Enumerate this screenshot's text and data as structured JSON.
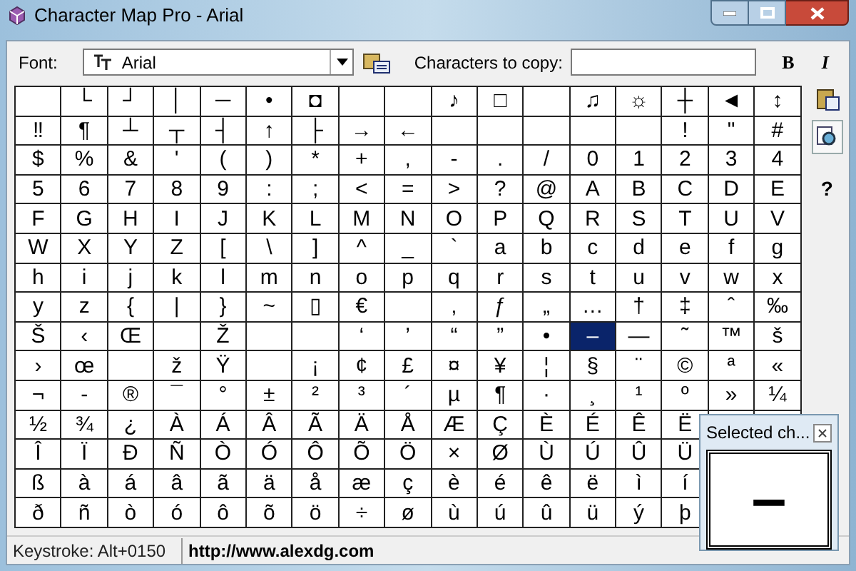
{
  "window": {
    "title": "Character Map Pro - Arial"
  },
  "toolbar": {
    "font_label": "Font:",
    "font_value": "Arial",
    "copy_label": "Characters to copy:",
    "bold": "B",
    "italic": "I"
  },
  "side_toolbar": {
    "help": "?"
  },
  "grid": {
    "rows": [
      [
        {
          "selected": false
        },
        {
          "ch": "└",
          "selected": false
        },
        {
          "ch": "┘",
          "selected": false
        },
        {
          "ch": "│",
          "selected": false
        },
        {
          "ch": "─",
          "selected": false
        },
        {
          "ch": "•",
          "selected": false
        },
        {
          "ch": "◘",
          "selected": false
        },
        {
          "selected": false
        },
        {
          "selected": false
        },
        {
          "ch": "♪",
          "selected": false
        },
        {
          "ch": "□",
          "selected": false
        },
        {
          "selected": false
        },
        {
          "ch": "♫",
          "selected": false
        },
        {
          "ch": "☼",
          "selected": false
        },
        {
          "ch": "┼",
          "selected": false
        },
        {
          "ch": "◄",
          "selected": false
        },
        {
          "ch": "↕",
          "selected": false
        }
      ],
      [
        {
          "ch": "‼",
          "selected": false
        },
        {
          "ch": "¶",
          "selected": false
        },
        {
          "ch": "┴",
          "selected": false
        },
        {
          "ch": "┬",
          "selected": false
        },
        {
          "ch": "┤",
          "selected": false
        },
        {
          "ch": "↑",
          "selected": false
        },
        {
          "ch": "├",
          "selected": false
        },
        {
          "ch": "→",
          "selected": false
        },
        {
          "ch": "←",
          "selected": false
        },
        {
          "selected": false
        },
        {
          "selected": false
        },
        {
          "selected": false
        },
        {
          "selected": false
        },
        {
          "selected": false
        },
        {
          "ch": "!",
          "selected": false
        },
        {
          "ch": "\"",
          "selected": false
        },
        {
          "ch": "#",
          "selected": false
        }
      ],
      [
        {
          "ch": "$",
          "selected": false
        },
        {
          "ch": "%",
          "selected": false
        },
        {
          "ch": "&",
          "selected": false
        },
        {
          "ch": "'",
          "selected": false
        },
        {
          "ch": "(",
          "selected": false
        },
        {
          "ch": ")",
          "selected": false
        },
        {
          "ch": "*",
          "selected": false
        },
        {
          "ch": "+",
          "selected": false
        },
        {
          "ch": ",",
          "selected": false
        },
        {
          "ch": "-",
          "selected": false
        },
        {
          "ch": ".",
          "selected": false
        },
        {
          "ch": "/",
          "selected": false
        },
        {
          "ch": "0",
          "selected": false
        },
        {
          "ch": "1",
          "selected": false
        },
        {
          "ch": "2",
          "selected": false
        },
        {
          "ch": "3",
          "selected": false
        },
        {
          "ch": "4",
          "selected": false
        }
      ],
      [
        {
          "ch": "5",
          "selected": false
        },
        {
          "ch": "6",
          "selected": false
        },
        {
          "ch": "7",
          "selected": false
        },
        {
          "ch": "8",
          "selected": false
        },
        {
          "ch": "9",
          "selected": false
        },
        {
          "ch": ":",
          "selected": false
        },
        {
          "ch": ";",
          "selected": false
        },
        {
          "ch": "<",
          "selected": false
        },
        {
          "ch": "=",
          "selected": false
        },
        {
          "ch": ">",
          "selected": false
        },
        {
          "ch": "?",
          "selected": false
        },
        {
          "ch": "@",
          "selected": false
        },
        {
          "ch": "A",
          "selected": false
        },
        {
          "ch": "B",
          "selected": false
        },
        {
          "ch": "C",
          "selected": false
        },
        {
          "ch": "D",
          "selected": false
        },
        {
          "ch": "E",
          "selected": false
        }
      ],
      [
        {
          "ch": "F",
          "selected": false
        },
        {
          "ch": "G",
          "selected": false
        },
        {
          "ch": "H",
          "selected": false
        },
        {
          "ch": "I",
          "selected": false
        },
        {
          "ch": "J",
          "selected": false
        },
        {
          "ch": "K",
          "selected": false
        },
        {
          "ch": "L",
          "selected": false
        },
        {
          "ch": "M",
          "selected": false
        },
        {
          "ch": "N",
          "selected": false
        },
        {
          "ch": "O",
          "selected": false
        },
        {
          "ch": "P",
          "selected": false
        },
        {
          "ch": "Q",
          "selected": false
        },
        {
          "ch": "R",
          "selected": false
        },
        {
          "ch": "S",
          "selected": false
        },
        {
          "ch": "T",
          "selected": false
        },
        {
          "ch": "U",
          "selected": false
        },
        {
          "ch": "V",
          "selected": false
        }
      ],
      [
        {
          "ch": "W",
          "selected": false
        },
        {
          "ch": "X",
          "selected": false
        },
        {
          "ch": "Y",
          "selected": false
        },
        {
          "ch": "Z",
          "selected": false
        },
        {
          "ch": "[",
          "selected": false
        },
        {
          "ch": "\\",
          "selected": false
        },
        {
          "ch": "]",
          "selected": false
        },
        {
          "ch": "^",
          "selected": false
        },
        {
          "ch": "_",
          "selected": false
        },
        {
          "ch": "`",
          "selected": false
        },
        {
          "ch": "a",
          "selected": false
        },
        {
          "ch": "b",
          "selected": false
        },
        {
          "ch": "c",
          "selected": false
        },
        {
          "ch": "d",
          "selected": false
        },
        {
          "ch": "e",
          "selected": false
        },
        {
          "ch": "f",
          "selected": false
        },
        {
          "ch": "g",
          "selected": false
        }
      ],
      [
        {
          "ch": "h",
          "selected": false
        },
        {
          "ch": "i",
          "selected": false
        },
        {
          "ch": "j",
          "selected": false
        },
        {
          "ch": "k",
          "selected": false
        },
        {
          "ch": "l",
          "selected": false
        },
        {
          "ch": "m",
          "selected": false
        },
        {
          "ch": "n",
          "selected": false
        },
        {
          "ch": "o",
          "selected": false
        },
        {
          "ch": "p",
          "selected": false
        },
        {
          "ch": "q",
          "selected": false
        },
        {
          "ch": "r",
          "selected": false
        },
        {
          "ch": "s",
          "selected": false
        },
        {
          "ch": "t",
          "selected": false
        },
        {
          "ch": "u",
          "selected": false
        },
        {
          "ch": "v",
          "selected": false
        },
        {
          "ch": "w",
          "selected": false
        },
        {
          "ch": "x",
          "selected": false
        }
      ],
      [
        {
          "ch": "y",
          "selected": false
        },
        {
          "ch": "z",
          "selected": false
        },
        {
          "ch": "{",
          "selected": false
        },
        {
          "ch": "|",
          "selected": false
        },
        {
          "ch": "}",
          "selected": false
        },
        {
          "ch": "~",
          "selected": false
        },
        {
          "ch": "▯",
          "selected": false
        },
        {
          "ch": "€",
          "selected": false
        },
        {
          "selected": false
        },
        {
          "ch": "‚",
          "selected": false
        },
        {
          "ch": "ƒ",
          "selected": false
        },
        {
          "ch": "„",
          "selected": false
        },
        {
          "ch": "…",
          "selected": false
        },
        {
          "ch": "†",
          "selected": false
        },
        {
          "ch": "‡",
          "selected": false
        },
        {
          "ch": "ˆ",
          "selected": false
        },
        {
          "ch": "‰",
          "selected": false
        }
      ],
      [
        {
          "ch": "Š",
          "selected": false
        },
        {
          "ch": "‹",
          "selected": false
        },
        {
          "ch": "Œ",
          "selected": false
        },
        {
          "selected": false
        },
        {
          "ch": "Ž",
          "selected": false
        },
        {
          "selected": false
        },
        {
          "selected": false
        },
        {
          "ch": "‘",
          "selected": false
        },
        {
          "ch": "’",
          "selected": false
        },
        {
          "ch": "“",
          "selected": false
        },
        {
          "ch": "”",
          "selected": false
        },
        {
          "ch": "•",
          "selected": false
        },
        {
          "ch": "–",
          "selected": true
        },
        {
          "ch": "—",
          "selected": false
        },
        {
          "ch": "˜",
          "selected": false
        },
        {
          "ch": "™",
          "selected": false
        },
        {
          "ch": "š",
          "selected": false
        }
      ],
      [
        {
          "ch": "›",
          "selected": false
        },
        {
          "ch": "œ",
          "selected": false
        },
        {
          "selected": false
        },
        {
          "ch": "ž",
          "selected": false
        },
        {
          "ch": "Ÿ",
          "selected": false
        },
        {
          "selected": false
        },
        {
          "ch": "¡",
          "selected": false
        },
        {
          "ch": "¢",
          "selected": false
        },
        {
          "ch": "£",
          "selected": false
        },
        {
          "ch": "¤",
          "selected": false
        },
        {
          "ch": "¥",
          "selected": false
        },
        {
          "ch": "¦",
          "selected": false
        },
        {
          "ch": "§",
          "selected": false
        },
        {
          "ch": "¨",
          "selected": false
        },
        {
          "ch": "©",
          "selected": false
        },
        {
          "ch": "ª",
          "selected": false
        },
        {
          "ch": "«",
          "selected": false
        }
      ],
      [
        {
          "ch": "¬",
          "selected": false
        },
        {
          "ch": "-",
          "selected": false
        },
        {
          "ch": "®",
          "selected": false
        },
        {
          "ch": "¯",
          "selected": false
        },
        {
          "ch": "°",
          "selected": false
        },
        {
          "ch": "±",
          "selected": false
        },
        {
          "ch": "²",
          "selected": false
        },
        {
          "ch": "³",
          "selected": false
        },
        {
          "ch": "´",
          "selected": false
        },
        {
          "ch": "µ",
          "selected": false
        },
        {
          "ch": "¶",
          "selected": false
        },
        {
          "ch": "·",
          "selected": false
        },
        {
          "ch": "¸",
          "selected": false
        },
        {
          "ch": "¹",
          "selected": false
        },
        {
          "ch": "º",
          "selected": false
        },
        {
          "ch": "»",
          "selected": false
        },
        {
          "ch": "¼",
          "selected": false
        }
      ],
      [
        {
          "ch": "½",
          "selected": false
        },
        {
          "ch": "¾",
          "selected": false
        },
        {
          "ch": "¿",
          "selected": false
        },
        {
          "ch": "À",
          "selected": false
        },
        {
          "ch": "Á",
          "selected": false
        },
        {
          "ch": "Â",
          "selected": false
        },
        {
          "ch": "Ã",
          "selected": false
        },
        {
          "ch": "Ä",
          "selected": false
        },
        {
          "ch": "Å",
          "selected": false
        },
        {
          "ch": "Æ",
          "selected": false
        },
        {
          "ch": "Ç",
          "selected": false
        },
        {
          "ch": "È",
          "selected": false
        },
        {
          "ch": "É",
          "selected": false
        },
        {
          "ch": "Ê",
          "selected": false
        },
        {
          "ch": "Ë",
          "selected": false
        }
      ],
      [
        {
          "ch": "Î",
          "selected": false
        },
        {
          "ch": "Ï",
          "selected": false
        },
        {
          "ch": "Ð",
          "selected": false
        },
        {
          "ch": "Ñ",
          "selected": false
        },
        {
          "ch": "Ò",
          "selected": false
        },
        {
          "ch": "Ó",
          "selected": false
        },
        {
          "ch": "Ô",
          "selected": false
        },
        {
          "ch": "Õ",
          "selected": false
        },
        {
          "ch": "Ö",
          "selected": false
        },
        {
          "ch": "×",
          "selected": false
        },
        {
          "ch": "Ø",
          "selected": false
        },
        {
          "ch": "Ù",
          "selected": false
        },
        {
          "ch": "Ú",
          "selected": false
        },
        {
          "ch": "Û",
          "selected": false
        },
        {
          "ch": "Ü",
          "selected": false
        }
      ],
      [
        {
          "ch": "ß",
          "selected": false
        },
        {
          "ch": "à",
          "selected": false
        },
        {
          "ch": "á",
          "selected": false
        },
        {
          "ch": "â",
          "selected": false
        },
        {
          "ch": "ã",
          "selected": false
        },
        {
          "ch": "ä",
          "selected": false
        },
        {
          "ch": "å",
          "selected": false
        },
        {
          "ch": "æ",
          "selected": false
        },
        {
          "ch": "ç",
          "selected": false
        },
        {
          "ch": "è",
          "selected": false
        },
        {
          "ch": "é",
          "selected": false
        },
        {
          "ch": "ê",
          "selected": false
        },
        {
          "ch": "ë",
          "selected": false
        },
        {
          "ch": "ì",
          "selected": false
        },
        {
          "ch": "í",
          "selected": false
        }
      ],
      [
        {
          "ch": "ð",
          "selected": false
        },
        {
          "ch": "ñ",
          "selected": false
        },
        {
          "ch": "ò",
          "selected": false
        },
        {
          "ch": "ó",
          "selected": false
        },
        {
          "ch": "ô",
          "selected": false
        },
        {
          "ch": "õ",
          "selected": false
        },
        {
          "ch": "ö",
          "selected": false
        },
        {
          "ch": "÷",
          "selected": false
        },
        {
          "ch": "ø",
          "selected": false
        },
        {
          "ch": "ù",
          "selected": false
        },
        {
          "ch": "ú",
          "selected": false
        },
        {
          "ch": "û",
          "selected": false
        },
        {
          "ch": "ü",
          "selected": false
        },
        {
          "ch": "ý",
          "selected": false
        },
        {
          "ch": "þ",
          "selected": false
        }
      ]
    ]
  },
  "status_bar": {
    "keystroke": "Keystroke: Alt+0150",
    "url": "http://www.alexdg.com"
  },
  "popup": {
    "title": "Selected ch...",
    "preview": "–"
  }
}
